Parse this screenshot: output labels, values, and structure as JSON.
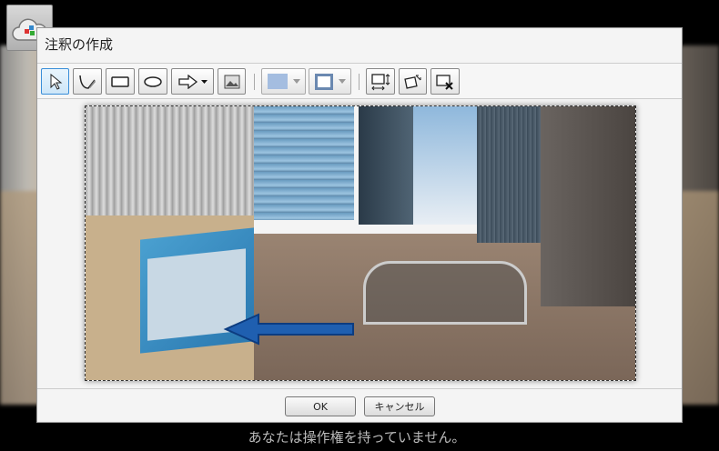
{
  "dialog": {
    "title": "注釈の作成"
  },
  "toolbar": {
    "tools": [
      "select-tool",
      "freehand-tool",
      "rectangle-tool",
      "ellipse-tool",
      "arrow-tool",
      "image-tool",
      "fill-color",
      "line-color",
      "resize-tool",
      "rotate-tool",
      "delete-tool"
    ],
    "fill_color": "#a4bde0",
    "line_color": "#6a88b0"
  },
  "annotation": {
    "arrow_color": "#1f5fb0"
  },
  "buttons": {
    "ok": "OK",
    "cancel": "キャンセル"
  },
  "status": "あなたは操作権を持っていません。"
}
